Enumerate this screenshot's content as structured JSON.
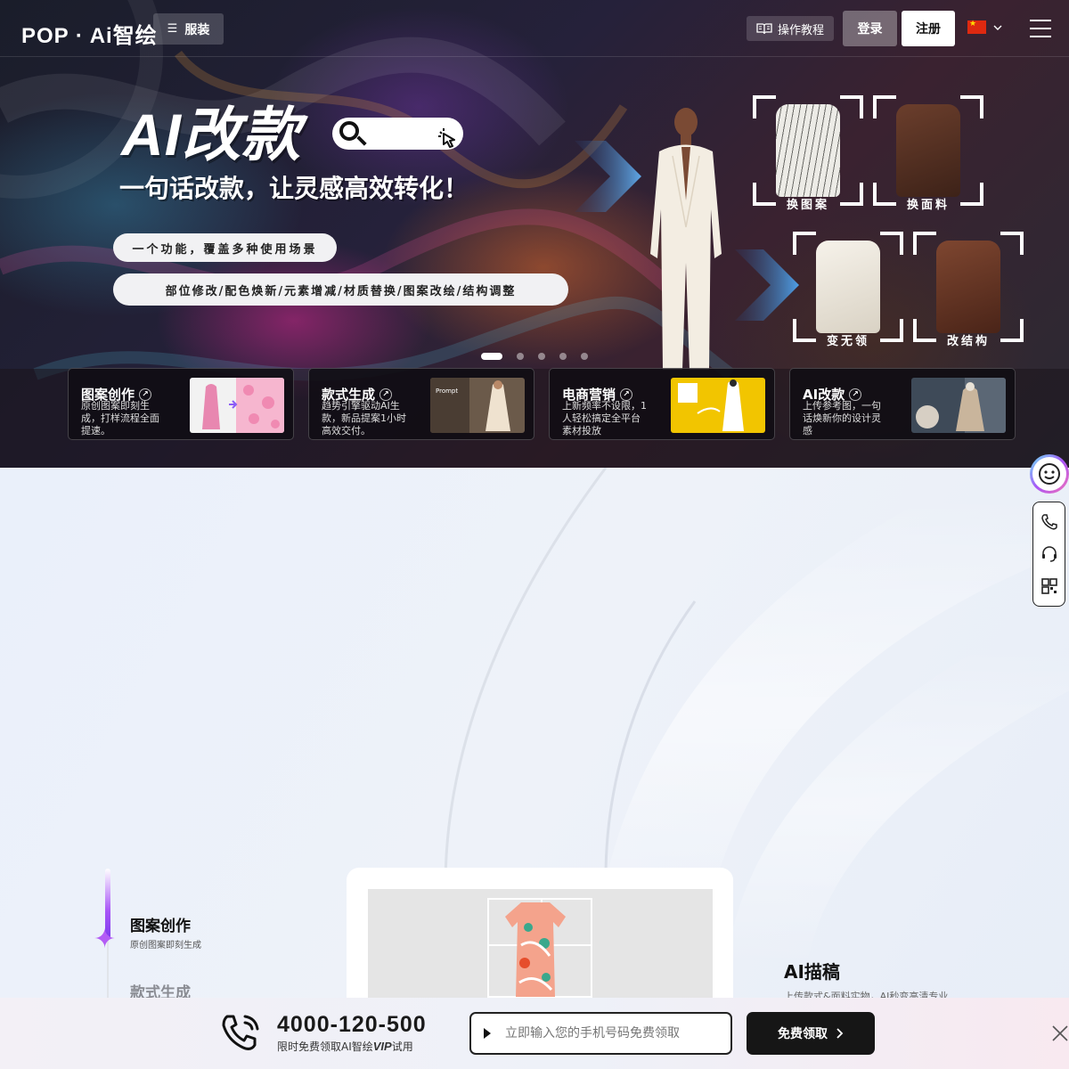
{
  "nav": {
    "logo": "POP · Ai智绘",
    "category": "服装",
    "tutorial": "操作教程",
    "login": "登录",
    "register": "注册"
  },
  "banner": {
    "title": "AI改款",
    "subtitle": "一句话改款，让灵感高效转化！",
    "pill_primary": "一个功能，覆盖多种使用场景",
    "pill_secondary": "部位修改/配色焕新/元素增减/材质替换/图案改绘/结构调整",
    "frames": [
      {
        "label": "换图案",
        "color": "#ecebe6"
      },
      {
        "label": "换面料",
        "color": "#5a3324"
      },
      {
        "label": "变无领",
        "color": "#f2eee6"
      },
      {
        "label": "改结构",
        "color": "#6e3a26"
      }
    ],
    "slide_count": 5,
    "active_slide": 1
  },
  "features": [
    {
      "title": "图案创作",
      "desc": "原创图案即刻生成，打样流程全面提速。"
    },
    {
      "title": "款式生成",
      "desc": "趋势引擎驱动AI生款，新品提案1小时高效交付。"
    },
    {
      "title": "电商营销",
      "desc": "上新频率不设限，1人轻松搞定全平台素材投放"
    },
    {
      "title": "AI改款",
      "desc": "上传参考图，一句话焕新你的设计灵感"
    }
  ],
  "feature_image_text": {
    "prompt_label": "Prompt"
  },
  "showcase": {
    "tab_active": "图案创作",
    "tab_active_desc": "原创图案即刻生成",
    "tab_next": "款式生成",
    "sketch_title": "AI描稿",
    "sketch_desc": "上传款式&面料实物，AI秒变高清专业"
  },
  "bottom": {
    "phone": "4000-120-500",
    "sub_prefix": "限时免费领取AI智绘",
    "sub_vip": "VIP",
    "sub_suffix": "试用",
    "placeholder": "立即输入您的手机号码免费领取",
    "button": "免费领取"
  },
  "colors": {
    "accent_purple": "#a855f7",
    "dark": "#161616"
  }
}
